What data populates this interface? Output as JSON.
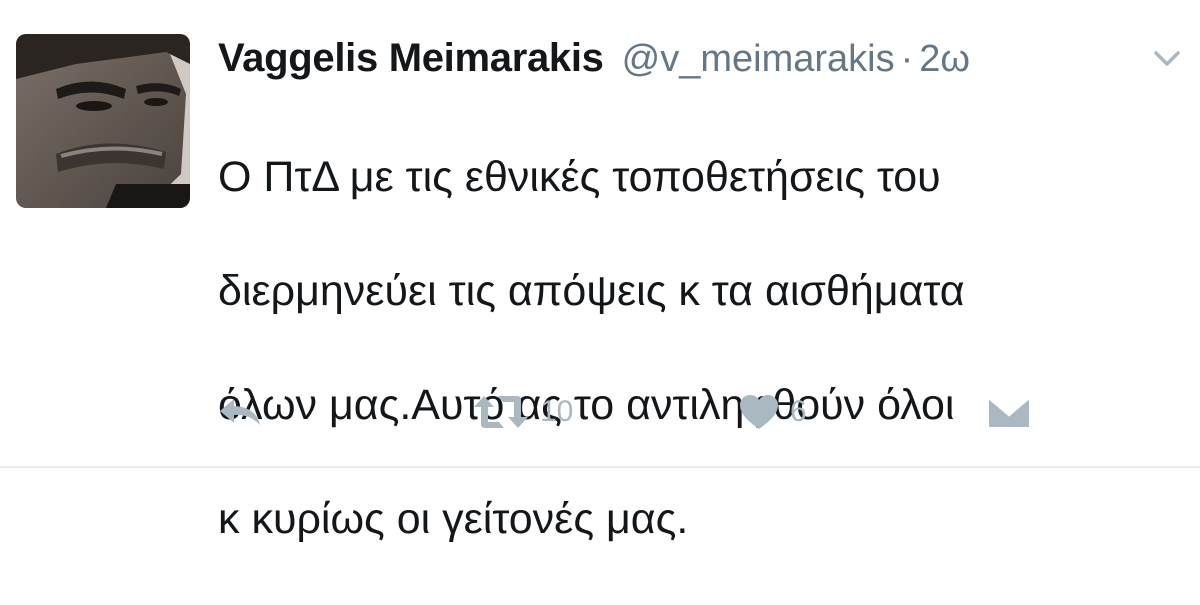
{
  "user": {
    "name": "Vaggelis Meimarakis",
    "handle": "@v_meimarakis",
    "separator": "·",
    "time": "2ω"
  },
  "tweet": {
    "lines": [
      "Ο ΠτΔ με τις εθνικές τοποθετήσεις του",
      "διερμηνεύει τις απόψεις κ τα αισθήματα",
      "όλων μας.Αυτό ας το αντιληφθούν όλοι",
      "κ κυρίως οι γείτονές μας."
    ]
  },
  "actions": {
    "reply_icon": "reply-icon",
    "retweet_icon": "retweet-icon",
    "retweet_count": "10",
    "like_icon": "heart-icon",
    "like_count": "6",
    "dm_icon": "envelope-icon"
  },
  "colors": {
    "text": "#14171a",
    "secondary": "#657786",
    "action_gray": "#aab8c2"
  }
}
